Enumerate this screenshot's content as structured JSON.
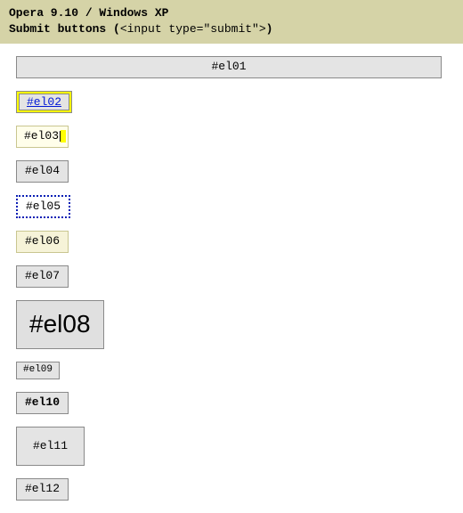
{
  "header": {
    "line1": "Opera 9.10 / Windows XP",
    "line2_text": "Submit buttons (",
    "line2_code": "<input type=\"submit\">",
    "line2_after": ")"
  },
  "buttons": {
    "el01": "#el01",
    "el02": "#el02",
    "el03": "#el03",
    "el04": "#el04",
    "el05": "#el05",
    "el06": "#el06",
    "el07": "#el07",
    "el08": "#el08",
    "el09": "#el09",
    "el10": "#el10",
    "el11": "#el11",
    "el12": "#el12"
  }
}
